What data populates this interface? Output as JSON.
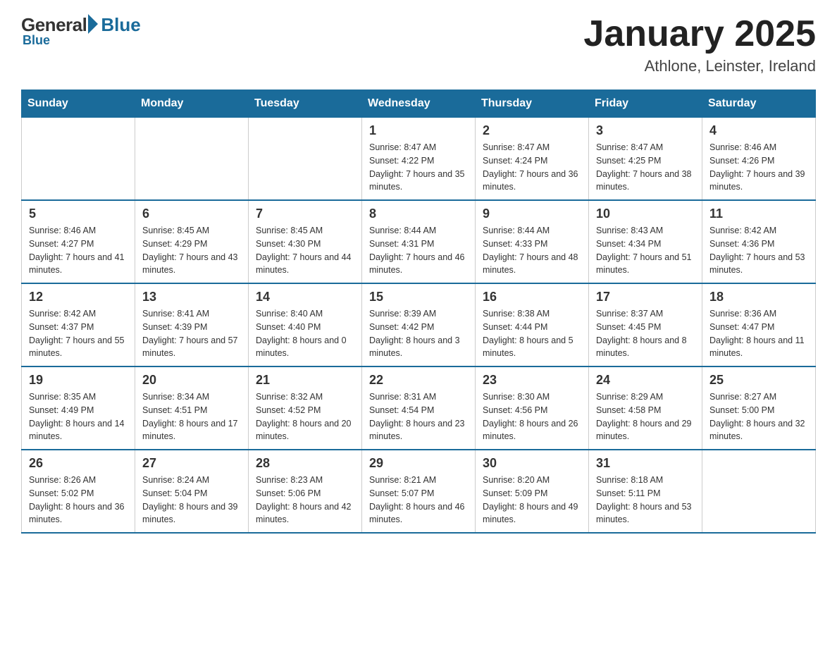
{
  "logo": {
    "general": "General",
    "blue": "Blue",
    "arrow": "▶"
  },
  "title": "January 2025",
  "subtitle": "Athlone, Leinster, Ireland",
  "days_of_week": [
    "Sunday",
    "Monday",
    "Tuesday",
    "Wednesday",
    "Thursday",
    "Friday",
    "Saturday"
  ],
  "weeks": [
    [
      {
        "day": "",
        "info": ""
      },
      {
        "day": "",
        "info": ""
      },
      {
        "day": "",
        "info": ""
      },
      {
        "day": "1",
        "info": "Sunrise: 8:47 AM\nSunset: 4:22 PM\nDaylight: 7 hours\nand 35 minutes."
      },
      {
        "day": "2",
        "info": "Sunrise: 8:47 AM\nSunset: 4:24 PM\nDaylight: 7 hours\nand 36 minutes."
      },
      {
        "day": "3",
        "info": "Sunrise: 8:47 AM\nSunset: 4:25 PM\nDaylight: 7 hours\nand 38 minutes."
      },
      {
        "day": "4",
        "info": "Sunrise: 8:46 AM\nSunset: 4:26 PM\nDaylight: 7 hours\nand 39 minutes."
      }
    ],
    [
      {
        "day": "5",
        "info": "Sunrise: 8:46 AM\nSunset: 4:27 PM\nDaylight: 7 hours\nand 41 minutes."
      },
      {
        "day": "6",
        "info": "Sunrise: 8:45 AM\nSunset: 4:29 PM\nDaylight: 7 hours\nand 43 minutes."
      },
      {
        "day": "7",
        "info": "Sunrise: 8:45 AM\nSunset: 4:30 PM\nDaylight: 7 hours\nand 44 minutes."
      },
      {
        "day": "8",
        "info": "Sunrise: 8:44 AM\nSunset: 4:31 PM\nDaylight: 7 hours\nand 46 minutes."
      },
      {
        "day": "9",
        "info": "Sunrise: 8:44 AM\nSunset: 4:33 PM\nDaylight: 7 hours\nand 48 minutes."
      },
      {
        "day": "10",
        "info": "Sunrise: 8:43 AM\nSunset: 4:34 PM\nDaylight: 7 hours\nand 51 minutes."
      },
      {
        "day": "11",
        "info": "Sunrise: 8:42 AM\nSunset: 4:36 PM\nDaylight: 7 hours\nand 53 minutes."
      }
    ],
    [
      {
        "day": "12",
        "info": "Sunrise: 8:42 AM\nSunset: 4:37 PM\nDaylight: 7 hours\nand 55 minutes."
      },
      {
        "day": "13",
        "info": "Sunrise: 8:41 AM\nSunset: 4:39 PM\nDaylight: 7 hours\nand 57 minutes."
      },
      {
        "day": "14",
        "info": "Sunrise: 8:40 AM\nSunset: 4:40 PM\nDaylight: 8 hours\nand 0 minutes."
      },
      {
        "day": "15",
        "info": "Sunrise: 8:39 AM\nSunset: 4:42 PM\nDaylight: 8 hours\nand 3 minutes."
      },
      {
        "day": "16",
        "info": "Sunrise: 8:38 AM\nSunset: 4:44 PM\nDaylight: 8 hours\nand 5 minutes."
      },
      {
        "day": "17",
        "info": "Sunrise: 8:37 AM\nSunset: 4:45 PM\nDaylight: 8 hours\nand 8 minutes."
      },
      {
        "day": "18",
        "info": "Sunrise: 8:36 AM\nSunset: 4:47 PM\nDaylight: 8 hours\nand 11 minutes."
      }
    ],
    [
      {
        "day": "19",
        "info": "Sunrise: 8:35 AM\nSunset: 4:49 PM\nDaylight: 8 hours\nand 14 minutes."
      },
      {
        "day": "20",
        "info": "Sunrise: 8:34 AM\nSunset: 4:51 PM\nDaylight: 8 hours\nand 17 minutes."
      },
      {
        "day": "21",
        "info": "Sunrise: 8:32 AM\nSunset: 4:52 PM\nDaylight: 8 hours\nand 20 minutes."
      },
      {
        "day": "22",
        "info": "Sunrise: 8:31 AM\nSunset: 4:54 PM\nDaylight: 8 hours\nand 23 minutes."
      },
      {
        "day": "23",
        "info": "Sunrise: 8:30 AM\nSunset: 4:56 PM\nDaylight: 8 hours\nand 26 minutes."
      },
      {
        "day": "24",
        "info": "Sunrise: 8:29 AM\nSunset: 4:58 PM\nDaylight: 8 hours\nand 29 minutes."
      },
      {
        "day": "25",
        "info": "Sunrise: 8:27 AM\nSunset: 5:00 PM\nDaylight: 8 hours\nand 32 minutes."
      }
    ],
    [
      {
        "day": "26",
        "info": "Sunrise: 8:26 AM\nSunset: 5:02 PM\nDaylight: 8 hours\nand 36 minutes."
      },
      {
        "day": "27",
        "info": "Sunrise: 8:24 AM\nSunset: 5:04 PM\nDaylight: 8 hours\nand 39 minutes."
      },
      {
        "day": "28",
        "info": "Sunrise: 8:23 AM\nSunset: 5:06 PM\nDaylight: 8 hours\nand 42 minutes."
      },
      {
        "day": "29",
        "info": "Sunrise: 8:21 AM\nSunset: 5:07 PM\nDaylight: 8 hours\nand 46 minutes."
      },
      {
        "day": "30",
        "info": "Sunrise: 8:20 AM\nSunset: 5:09 PM\nDaylight: 8 hours\nand 49 minutes."
      },
      {
        "day": "31",
        "info": "Sunrise: 8:18 AM\nSunset: 5:11 PM\nDaylight: 8 hours\nand 53 minutes."
      },
      {
        "day": "",
        "info": ""
      }
    ]
  ]
}
